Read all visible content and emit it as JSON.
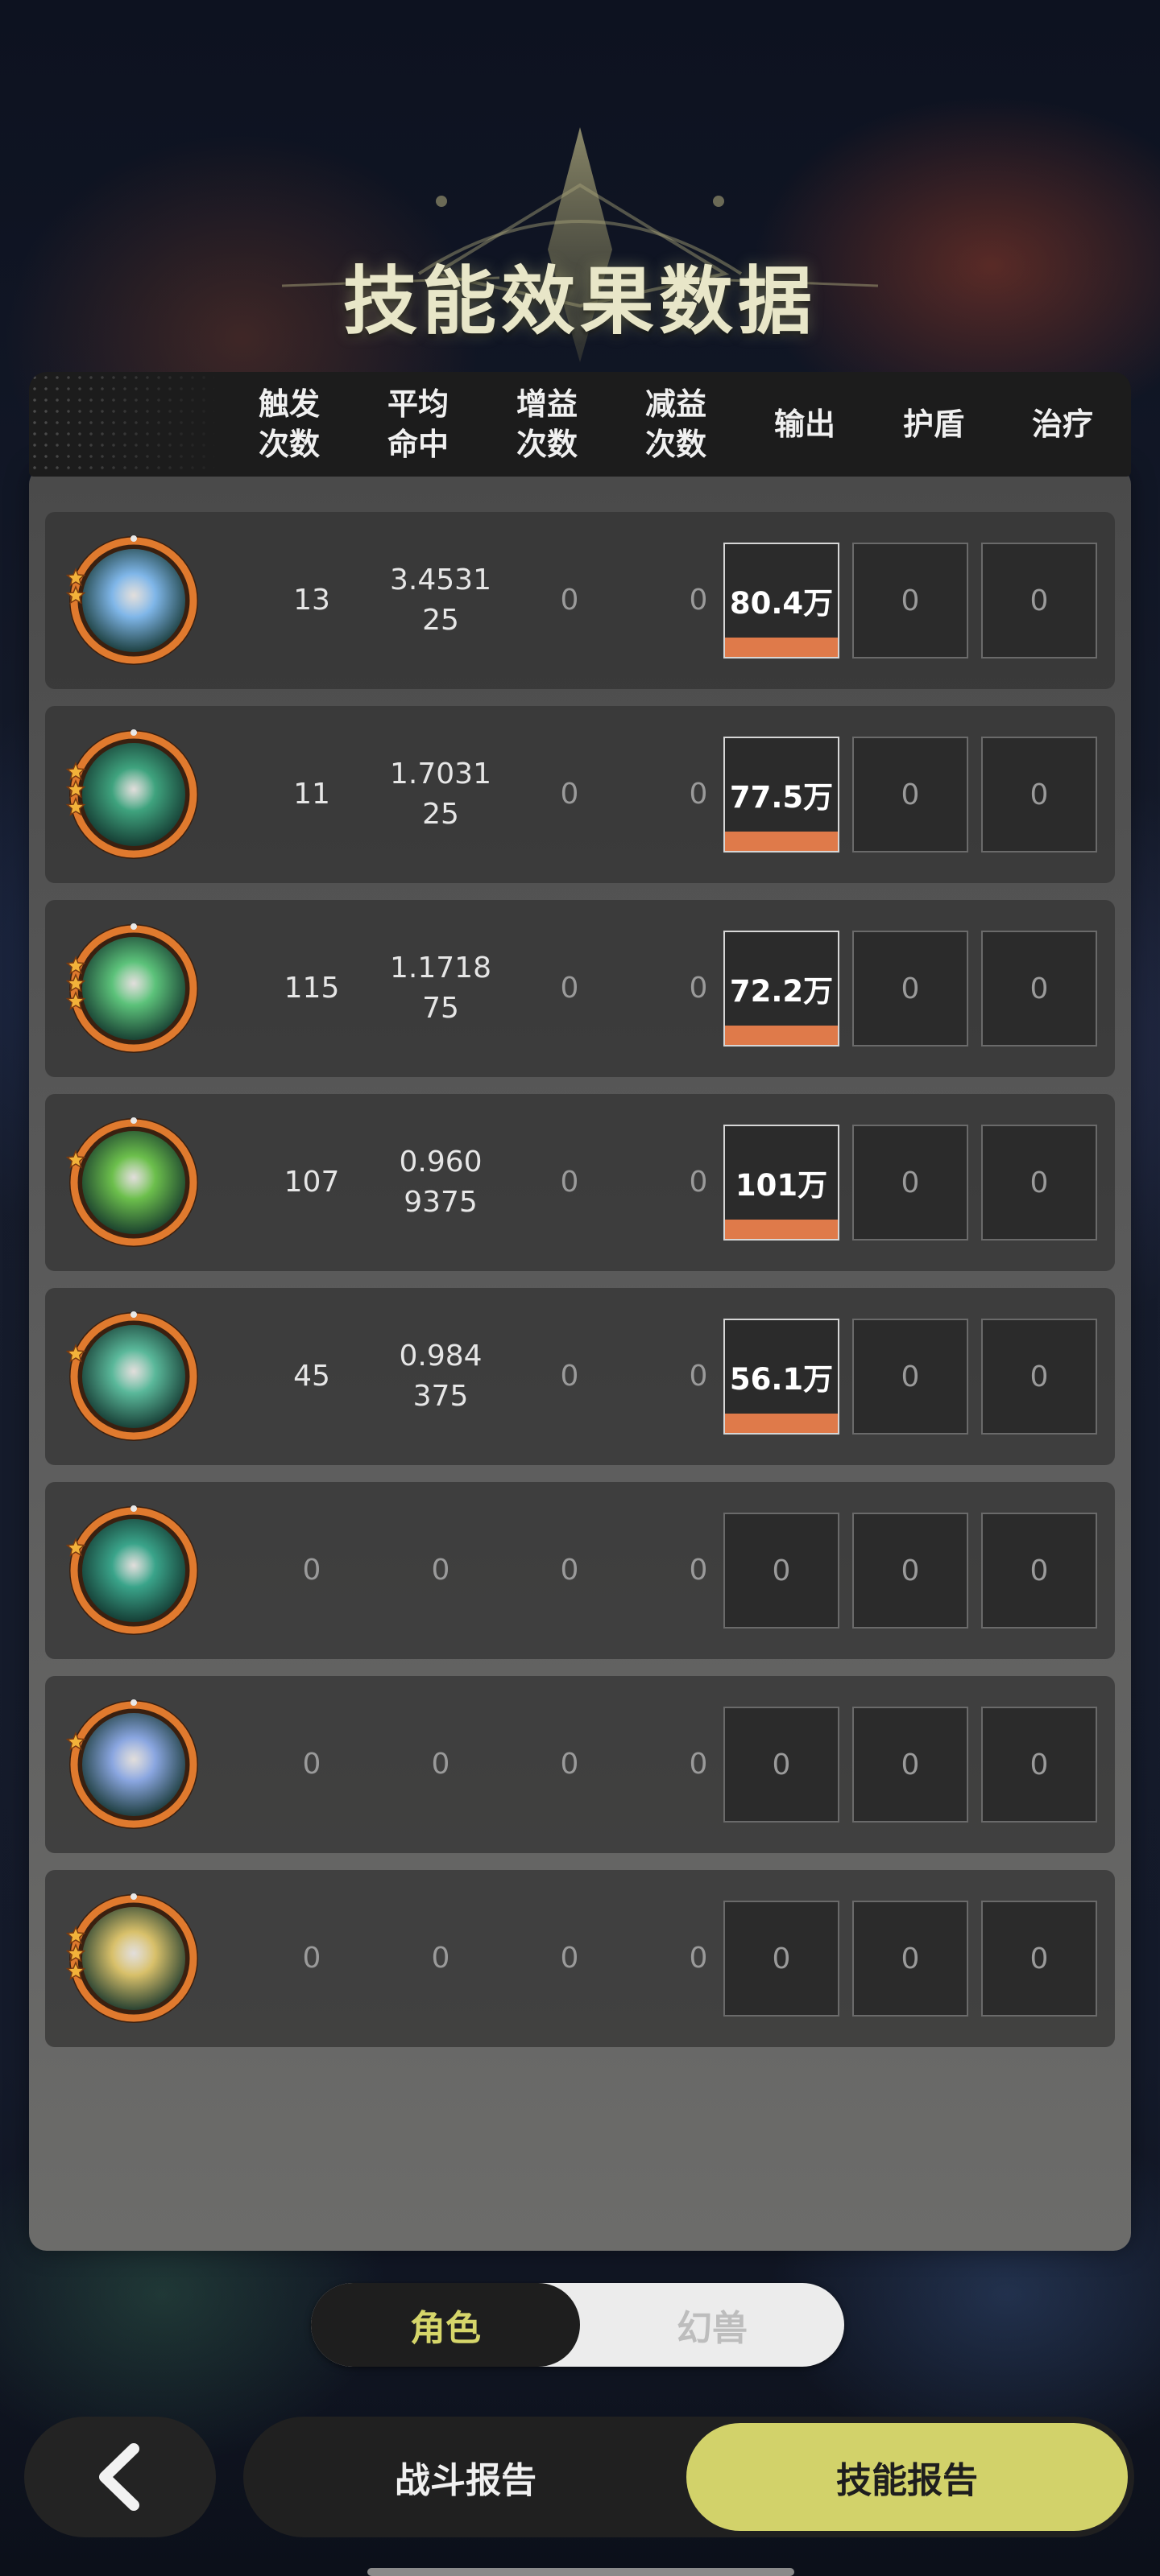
{
  "title": "技能效果数据",
  "headers": {
    "trigger": [
      "触发",
      "次数"
    ],
    "avg_hit": [
      "平均",
      "命中"
    ],
    "buff": [
      "增益",
      "次数"
    ],
    "debuff": [
      "减益",
      "次数"
    ],
    "output": "输出",
    "shield": "护盾",
    "heal": "治疗"
  },
  "rows": [
    {
      "icon": "ice-burst-skill-icon",
      "stars": 2,
      "theme": "#7fb6e8",
      "trigger": "13",
      "avg_hit": [
        "3.4531",
        "25"
      ],
      "buff": "0",
      "debuff": "0",
      "output": "80.4万",
      "output_fraction": 1,
      "shield": "0",
      "heal": "0"
    },
    {
      "icon": "thorn-vine-skill-icon",
      "stars": 3,
      "theme": "#3fa37e",
      "trigger": "11",
      "avg_hit": [
        "1.7031",
        "25"
      ],
      "buff": "0",
      "debuff": "0",
      "output": "77.5万",
      "output_fraction": 1,
      "shield": "0",
      "heal": "0"
    },
    {
      "icon": "green-wind-skill-icon",
      "stars": 3,
      "theme": "#5cc27a",
      "trigger": "115",
      "avg_hit": [
        "1.1718",
        "75"
      ],
      "buff": "0",
      "debuff": "0",
      "output": "72.2万",
      "output_fraction": 1,
      "shield": "0",
      "heal": "0"
    },
    {
      "icon": "tree-stump-skill-icon",
      "stars": 1,
      "theme": "#6cbf4c",
      "trigger": "107",
      "avg_hit": [
        "0.960",
        "9375"
      ],
      "buff": "0",
      "debuff": "0",
      "output": "101万",
      "output_fraction": 1,
      "shield": "0",
      "heal": "0"
    },
    {
      "icon": "spirit-orb-skill-icon",
      "stars": 1,
      "theme": "#5ab89a",
      "trigger": "45",
      "avg_hit": [
        "0.984",
        "375"
      ],
      "buff": "0",
      "debuff": "0",
      "output": "56.1万",
      "output_fraction": 1,
      "shield": "0",
      "heal": "0"
    },
    {
      "icon": "shadow-figure-skill-icon",
      "stars": 1,
      "theme": "#3aa48a",
      "trigger": "0",
      "avg_hit": [
        "0"
      ],
      "buff": "0",
      "debuff": "0",
      "output": "0",
      "output_fraction": 0,
      "shield": "0",
      "heal": "0"
    },
    {
      "icon": "blue-star-skill-icon",
      "stars": 1,
      "theme": "#8aa6e0",
      "trigger": "0",
      "avg_hit": [
        "0"
      ],
      "buff": "0",
      "debuff": "0",
      "output": "0",
      "output_fraction": 0,
      "shield": "0",
      "heal": "0"
    },
    {
      "icon": "golden-arrow-skill-icon",
      "stars": 3,
      "theme": "#d8c06a",
      "trigger": "0",
      "avg_hit": [
        "0"
      ],
      "buff": "0",
      "debuff": "0",
      "output": "0",
      "output_fraction": 0,
      "shield": "0",
      "heal": "0"
    }
  ],
  "toggle": {
    "left": "角色",
    "right": "幻兽",
    "active": "left"
  },
  "nav": {
    "back_icon": "chevron-left-icon",
    "battle_report": "战斗报告",
    "skill_report": "技能报告",
    "active": "skill_report"
  },
  "colors": {
    "accent": "#d2d26a",
    "output_bar": "#df7a4a",
    "icon_ring": "#e07a2e"
  }
}
